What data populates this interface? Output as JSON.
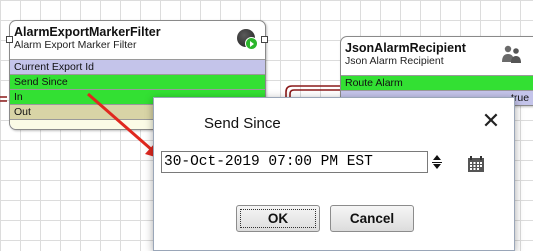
{
  "filter_block": {
    "title": "AlarmExportMarkerFilter",
    "subtitle": "Alarm Export Marker Filter",
    "slots": [
      "Current Export Id",
      "Send Since",
      "In",
      "Out"
    ],
    "status_icon": "running-status-icon"
  },
  "recipient_block": {
    "title": "JsonAlarmRecipient",
    "subtitle": "Json Alarm Recipient",
    "slots": [
      "Route Alarm",
      "true"
    ],
    "icon": "users-icon"
  },
  "dialog": {
    "title": "Send Since",
    "date_value": "30-Oct-2019 07:00 PM EST",
    "ok_label": "OK",
    "cancel_label": "Cancel",
    "close_glyph": "✕"
  },
  "colors": {
    "property_slot": "#c4c4ea",
    "action_slot": "#33e033",
    "topic_slot": "#d8d4a6",
    "annotation_arrow": "#e0281f",
    "link_wire": "#8b1a1a"
  }
}
